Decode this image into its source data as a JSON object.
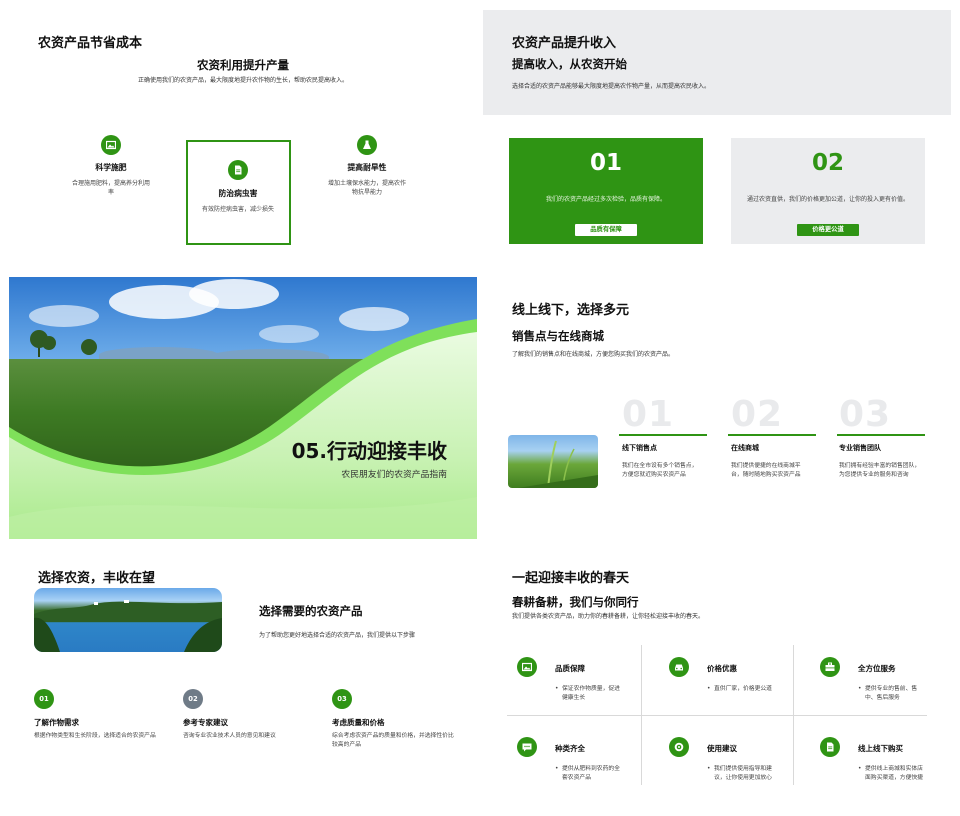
{
  "slide1": {
    "title": "农资产品节省成本",
    "subtitle": "农资利用提升产量",
    "intro": "正确使用我们的农资产品，最大限度地提升农作物的生长，帮助农民提高收入。",
    "items": [
      {
        "icon": "image-icon",
        "heading": "科学施肥",
        "desc": "合理施用肥料，提高养分利用率"
      },
      {
        "icon": "document-icon",
        "heading": "防治病虫害",
        "desc": "有效防控病虫害，减少损失"
      },
      {
        "icon": "flask-icon",
        "heading": "提高耐旱性",
        "desc": "增加土壤保水能力，提高农作物抗旱能力"
      }
    ]
  },
  "slide2": {
    "title": "农资产品提升收入",
    "subtitle": "提高收入，从农资开始",
    "intro": "选择合适的农资产品能够最大限度地提高农作物产量，从而提高农民收入。",
    "cards": [
      {
        "num": "01",
        "text": "我们的农资产品经过多次检验，品质有保障。",
        "pill": "品质有保障"
      },
      {
        "num": "02",
        "text": "通过农资直供，我们的价格更加公道，让你的投入更有价值。",
        "pill": "价格更公道"
      }
    ]
  },
  "slide3": {
    "heading": "05.行动迎接丰收",
    "subheading": "农民朋友们的农资产品指南"
  },
  "slide4": {
    "title": "线上线下，选择多元",
    "subtitle": "销售点与在线商城",
    "intro": "了解我们的销售点和在线商城，方便您购买我们的农资产品。",
    "items": [
      {
        "num": "01",
        "heading": "线下销售点",
        "desc": "我们在全市设有多个销售点，方便您就近购买农资产品"
      },
      {
        "num": "02",
        "heading": "在线商城",
        "desc": "我们提供便捷的在线商城平台，随时随地购买农资产品"
      },
      {
        "num": "03",
        "heading": "专业销售团队",
        "desc": "我们拥有经验丰富的销售团队，为您提供专业的服务和咨询"
      }
    ]
  },
  "slide5": {
    "title": "选择农资，丰收在望",
    "subtitle": "选择需要的农资产品",
    "intro": "为了帮助您更好地选择合适的农资产品，我们提供以下步骤",
    "steps": [
      {
        "num": "01",
        "heading": "了解作物需求",
        "desc": "根据作物类型和生长阶段，选择适合的农资产品",
        "color": "#2f9414"
      },
      {
        "num": "02",
        "heading": "参考专家建议",
        "desc": "咨询专业农业技术人员的意见和建议",
        "color": "#6f7b87"
      },
      {
        "num": "03",
        "heading": "考虑质量和价格",
        "desc": "综合考虑农资产品的质量和价格，并选择性价比较高的产品",
        "color": "#2f9414"
      }
    ]
  },
  "slide6": {
    "title": "一起迎接丰收的春天",
    "subtitle": "春耕备耕，我们与你同行",
    "intro": "我们提供各类农资产品，助力你的春耕备耕，让你轻松迎接丰收的春天。",
    "items": [
      {
        "icon": "image-icon",
        "heading": "品质保障",
        "desc": "保证农作物质量，促进健康生长"
      },
      {
        "icon": "car-icon",
        "heading": "价格优惠",
        "desc": "直供厂家，价格更公道"
      },
      {
        "icon": "toolbox-icon",
        "heading": "全方位服务",
        "desc": "提供专业的售前、售中、售后服务"
      },
      {
        "icon": "chat-icon",
        "heading": "种类齐全",
        "desc": "提供从肥料到农药的全套农资产品"
      },
      {
        "icon": "target-icon",
        "heading": "使用建议",
        "desc": "我们提供使用指导和建议，让你使用更加放心"
      },
      {
        "icon": "document-icon",
        "heading": "线上线下购买",
        "desc": "提供线上商城和实体店面购买渠道，方便快捷"
      }
    ]
  },
  "colors": {
    "accent": "#2f9414",
    "gray": "#6f7b87",
    "panel": "#ebecee"
  }
}
